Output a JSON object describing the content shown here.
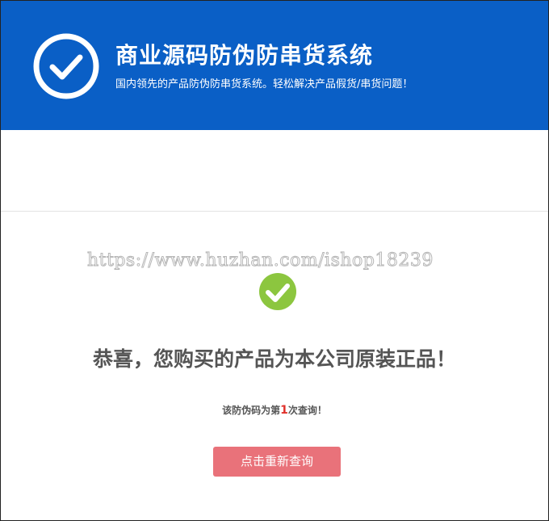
{
  "header": {
    "title": "商业源码防伪防串货系统",
    "subtitle": "国内领先的产品防伪防串货系统。轻松解决产品假货/串货问题！",
    "logo_icon": "check-circle-icon",
    "background_color": "#0a5fc6"
  },
  "watermark": {
    "text": "https://www.huzhan.com/ishop18239"
  },
  "result": {
    "icon": "check-circle-filled-icon",
    "icon_color": "#8cc63f",
    "message": "恭喜，您购买的产品为本公司原装正品！",
    "query_prefix": "该防伪码为第",
    "query_count": "1",
    "query_suffix": "次查询！",
    "count_color": "#e0312b"
  },
  "actions": {
    "requery_label": "点击重新查询",
    "button_color": "#e9727a"
  }
}
